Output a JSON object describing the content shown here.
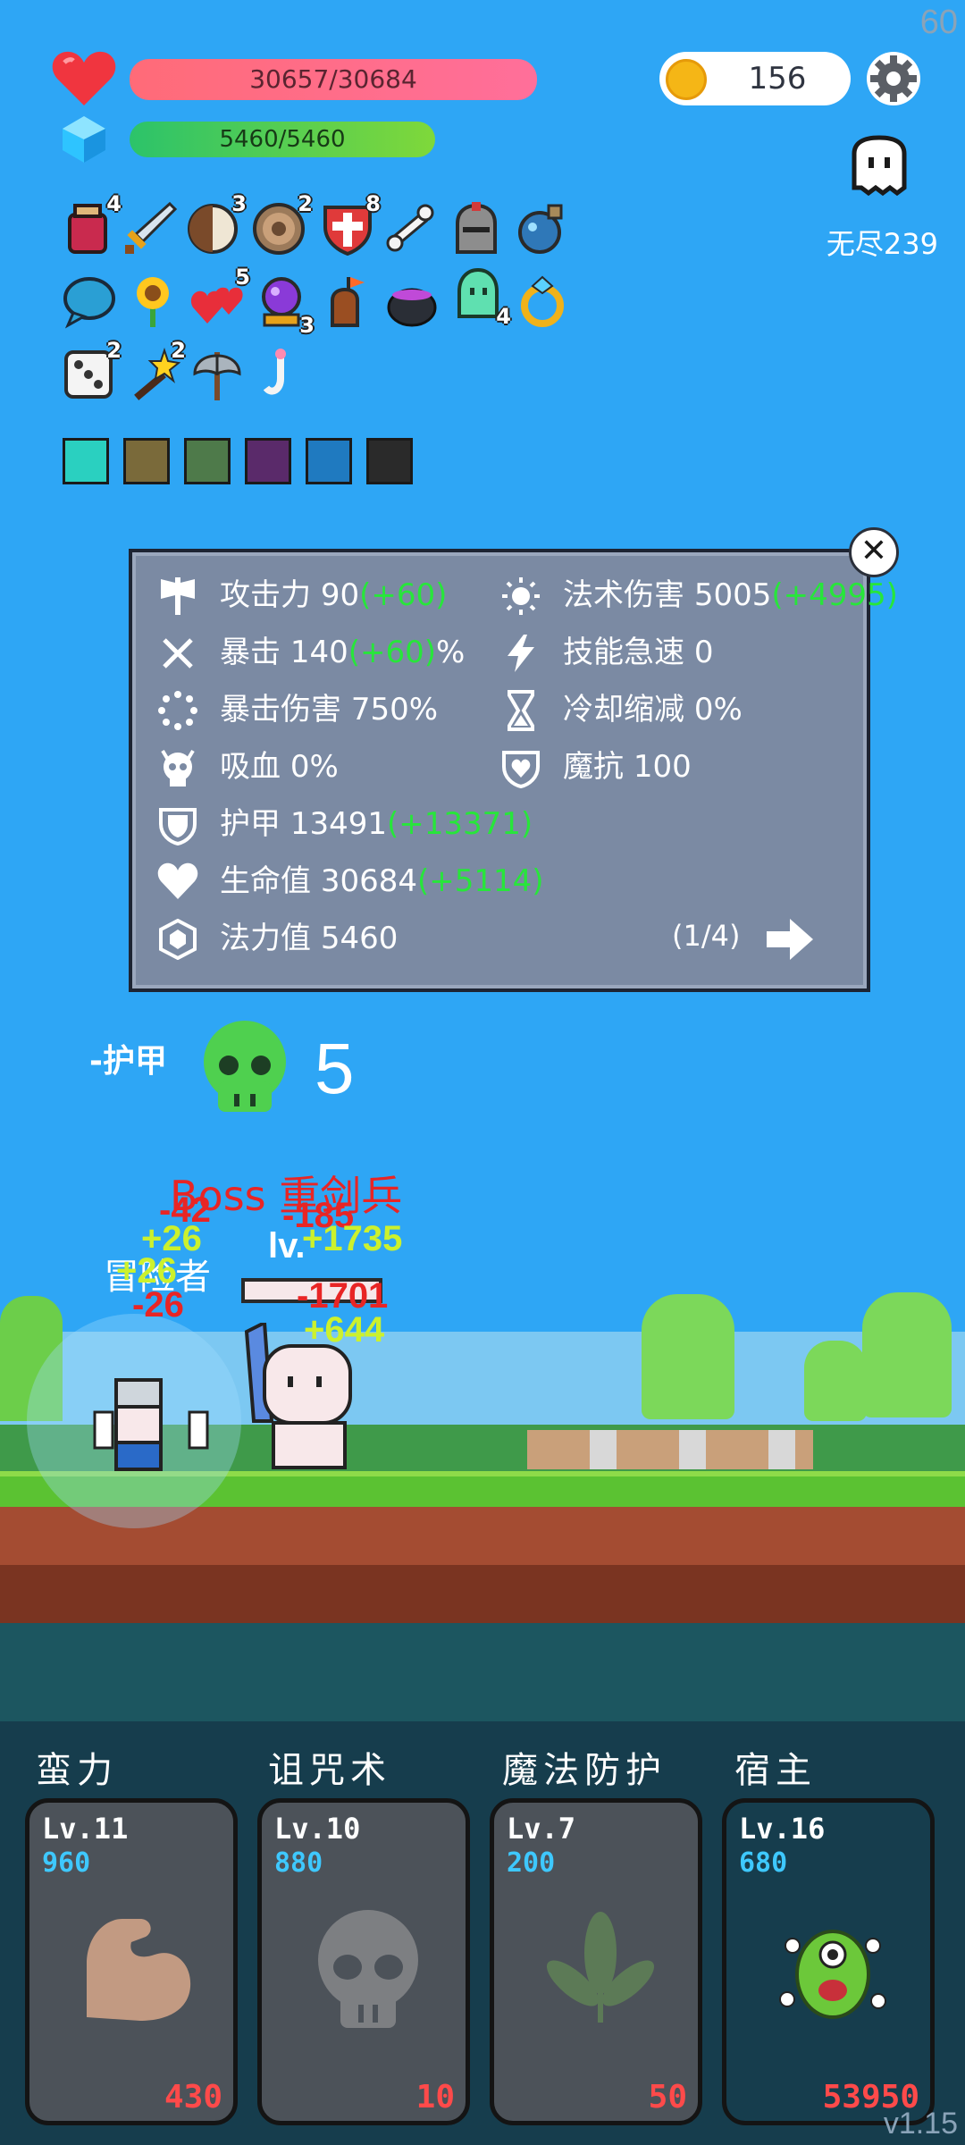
{
  "fps": "60",
  "version": "v1.15",
  "hud": {
    "hp_text": "30657/30684",
    "hp_fraction": 0.999,
    "mp_text": "5460/5460",
    "mp_fraction": 1.0,
    "coins": "156",
    "endless_label": "无尽239"
  },
  "inventory": {
    "badges": {
      "potion": "4",
      "shield_round": "3",
      "target": "2",
      "shield_cross": "8",
      "hearts": "5",
      "crystal_ball": "3",
      "slime": "4",
      "dice": "2",
      "wand": "2"
    },
    "icons": [
      "potion-icon",
      "sword-icon",
      "shield-round-icon",
      "target-icon",
      "shield-cross-icon",
      "bone-icon",
      "helmet-icon",
      "orb-icon",
      "speech-bubble-icon",
      "sunflower-icon",
      "hearts-icon",
      "crystal-ball-icon",
      "drumstick-icon",
      "cauldron-icon",
      "slime-icon",
      "ring-icon",
      "dice-icon",
      "wand-icon",
      "axe-icon",
      "hook-icon"
    ]
  },
  "stats_panel": {
    "attack_label": "攻击力",
    "attack_value": "90",
    "attack_bonus": "(+60)",
    "crit_label": "暴击",
    "crit_value": "140",
    "crit_bonus": "(+60)",
    "crit_unit": "%",
    "crit_dmg_label": "暴击伤害",
    "crit_dmg_value": "750%",
    "lifesteal_label": "吸血",
    "lifesteal_value": "0%",
    "armor_label": "护甲",
    "armor_value": "13491",
    "armor_bonus": "(+13371)",
    "hp_label": "生命值",
    "hp_value": "30684",
    "hp_bonus": "(+5114)",
    "mana_label": "法力值",
    "mana_value": "5460",
    "spell_label": "法术伤害",
    "spell_value": "5005",
    "spell_bonus": "(+4995)",
    "haste_label": "技能急速",
    "haste_value": "0",
    "cdr_label": "冷却缩减",
    "cdr_value": "0%",
    "mr_label": "魔抗",
    "mr_value": "100",
    "page": "(1/4)"
  },
  "battle": {
    "debuff_label": "-护甲",
    "skull_count": "5",
    "boss_label": "Boss 重剑兵",
    "enemy_level": "lv.",
    "hero_label": "冒险者",
    "floats": {
      "a": "-42",
      "b": "+26",
      "c": "-26",
      "d": "+26",
      "e": "-185",
      "f": "+1735",
      "g": "-1701",
      "h": "+644"
    }
  },
  "skills": [
    {
      "title": "蛮力",
      "level": "Lv.11",
      "cost": "960",
      "price": "430",
      "icon": "muscle-arm-icon"
    },
    {
      "title": "诅咒术",
      "level": "Lv.10",
      "cost": "880",
      "price": "10",
      "icon": "skull-icon"
    },
    {
      "title": "魔法防护",
      "level": "Lv.7",
      "cost": "200",
      "price": "50",
      "icon": "leaf-icon"
    },
    {
      "title": "宿主",
      "level": "Lv.16",
      "cost": "680",
      "price": "53950",
      "icon": "green-monster-icon"
    }
  ]
}
